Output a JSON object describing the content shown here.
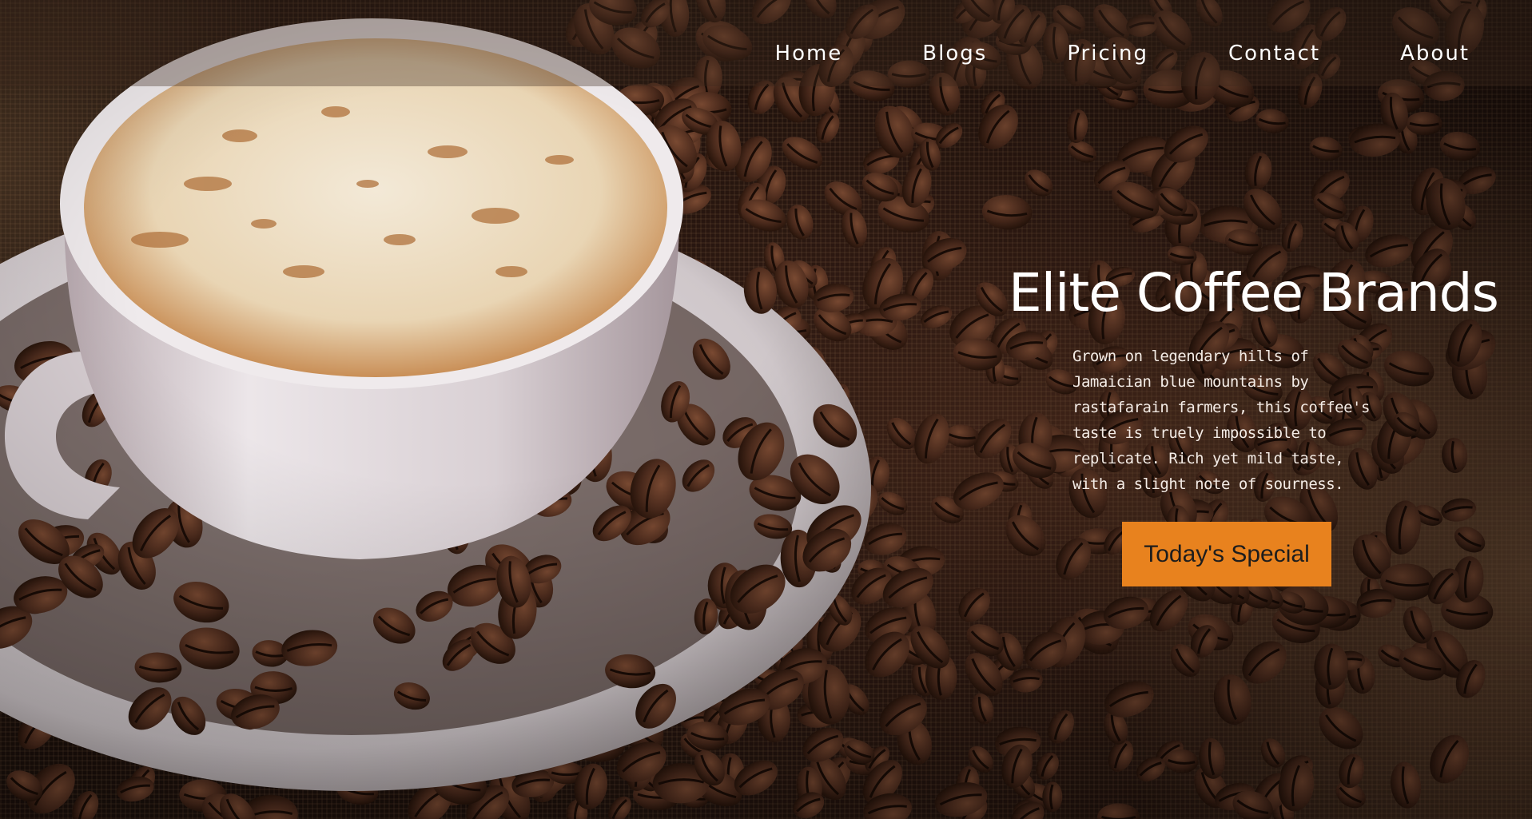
{
  "nav": {
    "items": [
      {
        "label": "Home"
      },
      {
        "label": "Blogs"
      },
      {
        "label": "Pricing"
      },
      {
        "label": "Contact"
      },
      {
        "label": "About"
      }
    ]
  },
  "hero": {
    "title": "Elite Coffee Brands",
    "description": "Grown on legendary hills of Jamaician blue mountains by rastafarain farmers, this coffee's taste is truely impossible to replicate. Rich yet mild taste, with a slight note of sourness.",
    "button_label": "Today's Special"
  },
  "colors": {
    "accent": "#e8821e",
    "text": "#ffffff"
  }
}
